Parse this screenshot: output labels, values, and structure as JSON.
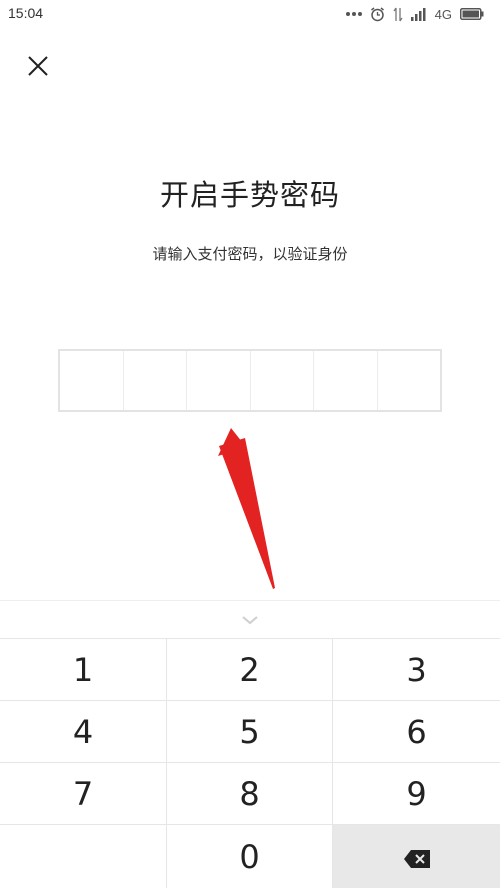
{
  "status_bar": {
    "time": "15:04",
    "network": "4G",
    "icons": [
      "more-dots-icon",
      "alarm-icon",
      "signal-transfer-icon",
      "signal-icon",
      "battery-icon"
    ]
  },
  "header": {
    "close_icon": "close-icon"
  },
  "main": {
    "title": "开启手势密码",
    "subtitle": "请输入支付密码，以验证身份",
    "pin_length": 6,
    "pin_value": ""
  },
  "annotation": {
    "arrow_color": "#e32222"
  },
  "keypad": {
    "collapse_icon": "chevron-down-icon",
    "keys": [
      "1",
      "2",
      "3",
      "4",
      "5",
      "6",
      "7",
      "8",
      "9",
      "",
      "0"
    ],
    "delete_icon": "backspace-icon"
  }
}
